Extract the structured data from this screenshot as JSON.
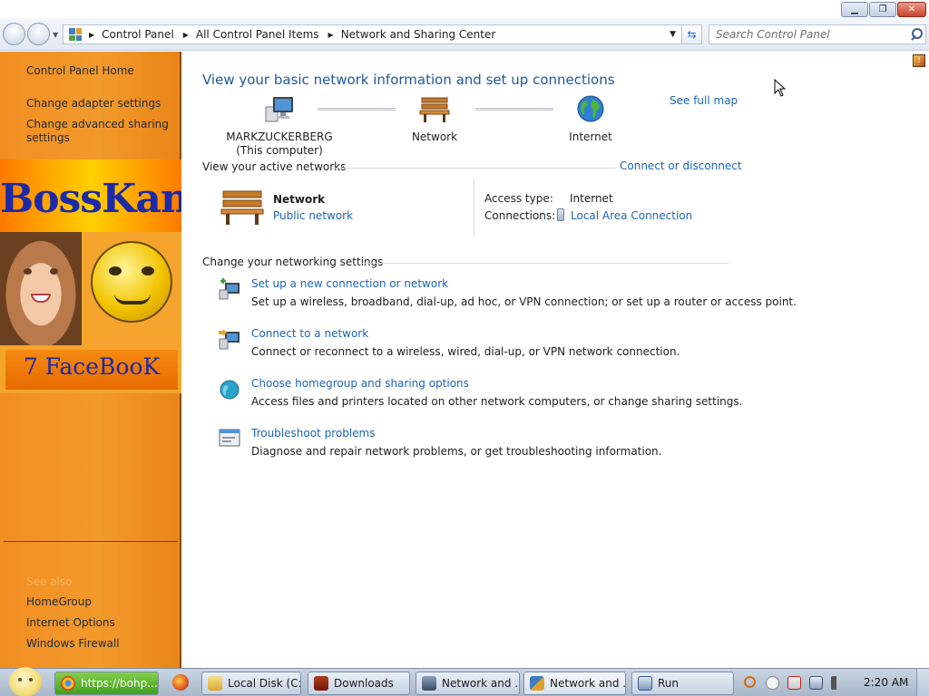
{
  "window": {
    "minimize_glyph": "▁",
    "restore_glyph": "❐",
    "close_glyph": "✕"
  },
  "address_bar": {
    "breadcrumbs": [
      "Control Panel",
      "All Control Panel Items",
      "Network and Sharing Center"
    ],
    "refresh_glyph": "⇆",
    "search_placeholder": "Search Control Panel"
  },
  "sidebar": {
    "home": "Control Panel Home",
    "links": [
      "Change adapter settings",
      "Change advanced sharing settings"
    ],
    "banner_title": "BossKanae",
    "banner_subtitle": "7 FaceBooK",
    "see_also_label": "See also",
    "see_also": [
      "HomeGroup",
      "Internet Options",
      "Windows Firewall"
    ]
  },
  "main": {
    "title": "View your basic network information and set up connections",
    "see_full_map": "See full map",
    "map_nodes": [
      {
        "name": "MARKZUCKERBERG",
        "sub": "(This computer)"
      },
      {
        "name": "Network",
        "sub": ""
      },
      {
        "name": "Internet",
        "sub": ""
      }
    ],
    "active_networks_heading": "View your active networks",
    "connect_disconnect": "Connect or disconnect",
    "active_network": {
      "name": "Network",
      "type": "Public network",
      "access_type_label": "Access type:",
      "access_type": "Internet",
      "connections_label": "Connections:",
      "connection": "Local Area Connection"
    },
    "settings_heading": "Change your networking settings",
    "tasks": [
      {
        "title": "Set up a new connection or network",
        "desc": "Set up a wireless, broadband, dial-up, ad hoc, or VPN connection; or set up a router or access point."
      },
      {
        "title": "Connect to a network",
        "desc": "Connect or reconnect to a wireless, wired, dial-up, or VPN network connection."
      },
      {
        "title": "Choose homegroup and sharing options",
        "desc": "Access files and printers located on other network computers, or change sharing settings."
      },
      {
        "title": "Troubleshoot problems",
        "desc": "Diagnose and repair network problems, or get troubleshooting information."
      }
    ]
  },
  "taskbar": {
    "buttons": [
      {
        "label": "https://bohp...",
        "icon": "chrome-icon"
      },
      {
        "label": "Local Disk (C:)",
        "icon": "folder-icon"
      },
      {
        "label": "Downloads",
        "icon": "downloads-icon"
      },
      {
        "label": "Network and ...",
        "icon": "network-icon"
      },
      {
        "label": "Network and ...",
        "icon": "control-panel-icon"
      },
      {
        "label": "Run",
        "icon": "run-icon"
      }
    ],
    "clock": "2:20 AM"
  },
  "colors": {
    "link": "#1b65b5",
    "sidebar_orange": "#f39a2c",
    "title_blue": "#1e5a9e"
  }
}
